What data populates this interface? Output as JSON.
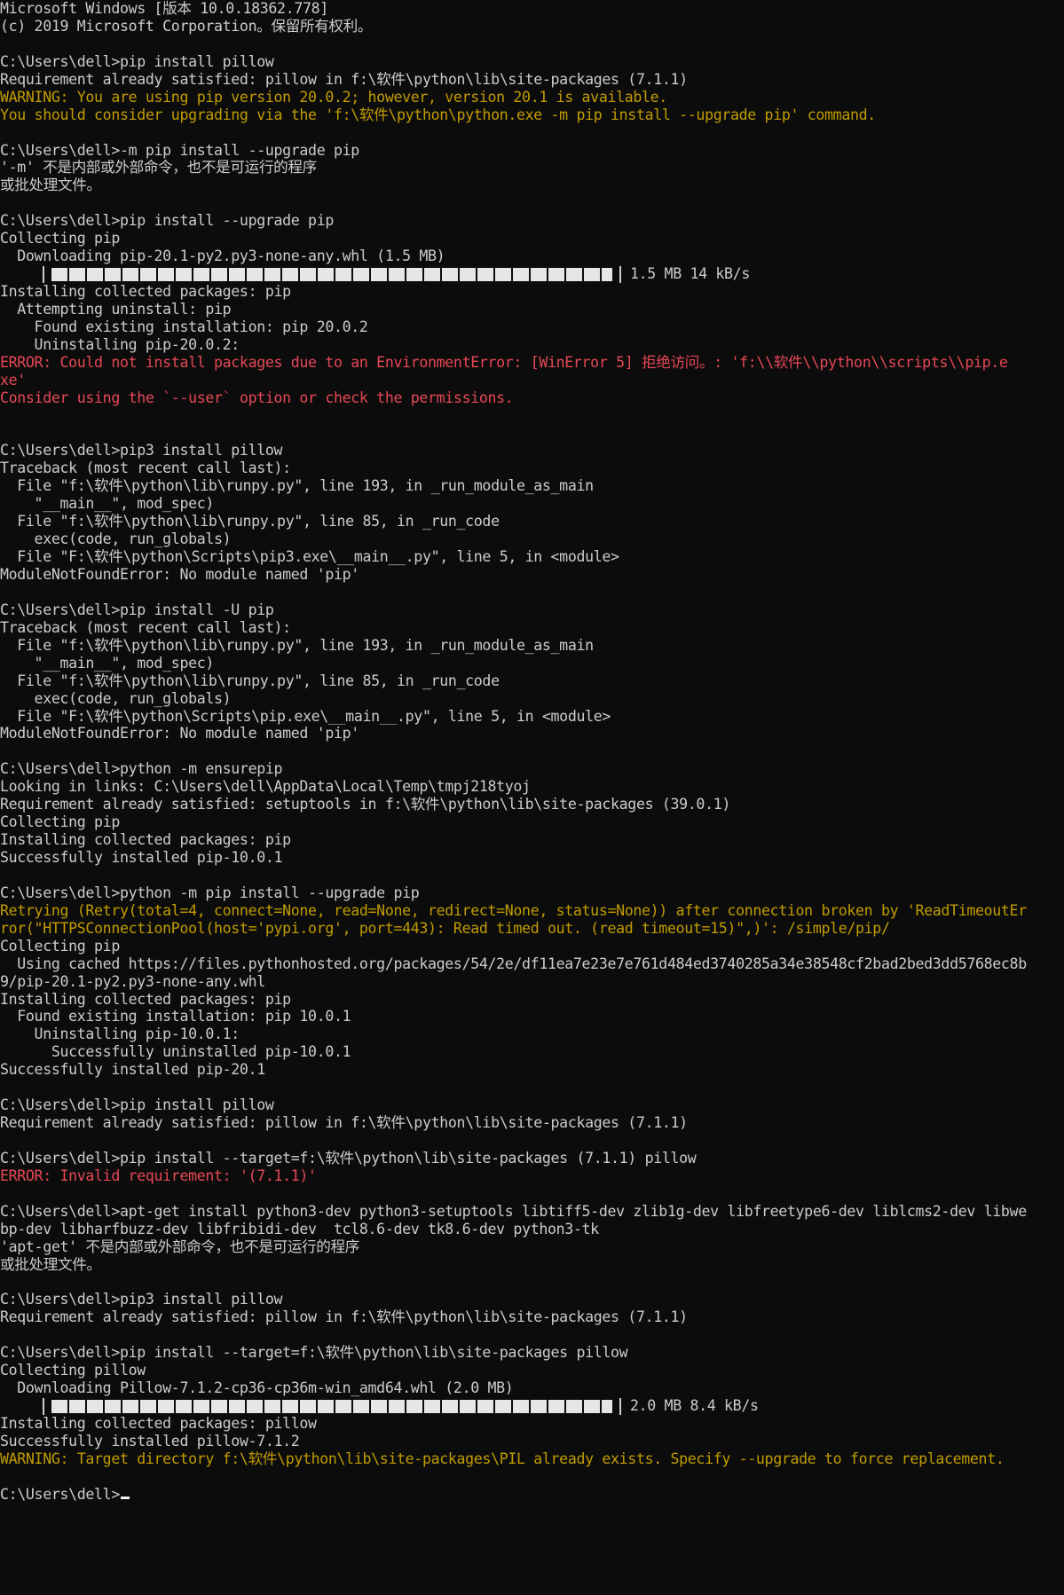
{
  "console": {
    "lines": [
      {
        "t": "Microsoft Windows [版本 10.0.18362.778]",
        "c": "normal"
      },
      {
        "t": "(c) 2019 Microsoft Corporation。保留所有权利。",
        "c": "normal"
      },
      {
        "t": "",
        "c": "normal"
      },
      {
        "t": "C:\\Users\\dell>pip install pillow",
        "c": "normal"
      },
      {
        "t": "Requirement already satisfied: pillow in f:\\软件\\python\\lib\\site-packages (7.1.1)",
        "c": "normal"
      },
      {
        "t": "WARNING: You are using pip version 20.0.2; however, version 20.1 is available.",
        "c": "warn"
      },
      {
        "t": "You should consider upgrading via the 'f:\\软件\\python\\python.exe -m pip install --upgrade pip' command.",
        "c": "warn"
      },
      {
        "t": "",
        "c": "normal"
      },
      {
        "t": "C:\\Users\\dell>-m pip install --upgrade pip",
        "c": "normal"
      },
      {
        "t": "'-m' 不是内部或外部命令，也不是可运行的程序",
        "c": "normal"
      },
      {
        "t": "或批处理文件。",
        "c": "normal"
      },
      {
        "t": "",
        "c": "normal"
      },
      {
        "t": "C:\\Users\\dell>pip install --upgrade pip",
        "c": "normal"
      },
      {
        "t": "Collecting pip",
        "c": "normal"
      },
      {
        "t": "  Downloading pip-20.1-py2.py3-none-any.whl (1.5 MB)",
        "c": "normal"
      },
      {
        "type": "progress",
        "fill": 1.0,
        "text": "1.5 MB 14 kB/s"
      },
      {
        "t": "Installing collected packages: pip",
        "c": "normal"
      },
      {
        "t": "  Attempting uninstall: pip",
        "c": "normal"
      },
      {
        "t": "    Found existing installation: pip 20.0.2",
        "c": "normal"
      },
      {
        "t": "    Uninstalling pip-20.0.2:",
        "c": "normal"
      },
      {
        "t": "ERROR: Could not install packages due to an EnvironmentError: [WinError 5] 拒绝访问。: 'f:\\\\软件\\\\python\\\\scripts\\\\pip.e",
        "c": "err"
      },
      {
        "t": "xe'",
        "c": "err"
      },
      {
        "t": "Consider using the `--user` option or check the permissions.",
        "c": "err"
      },
      {
        "t": "",
        "c": "normal"
      },
      {
        "t": "",
        "c": "normal"
      },
      {
        "t": "C:\\Users\\dell>pip3 install pillow",
        "c": "normal"
      },
      {
        "t": "Traceback (most recent call last):",
        "c": "normal"
      },
      {
        "t": "  File \"f:\\软件\\python\\lib\\runpy.py\", line 193, in _run_module_as_main",
        "c": "normal"
      },
      {
        "t": "    \"__main__\", mod_spec)",
        "c": "normal"
      },
      {
        "t": "  File \"f:\\软件\\python\\lib\\runpy.py\", line 85, in _run_code",
        "c": "normal"
      },
      {
        "t": "    exec(code, run_globals)",
        "c": "normal"
      },
      {
        "t": "  File \"F:\\软件\\python\\Scripts\\pip3.exe\\__main__.py\", line 5, in <module>",
        "c": "normal"
      },
      {
        "t": "ModuleNotFoundError: No module named 'pip'",
        "c": "normal"
      },
      {
        "t": "",
        "c": "normal"
      },
      {
        "t": "C:\\Users\\dell>pip install -U pip",
        "c": "normal"
      },
      {
        "t": "Traceback (most recent call last):",
        "c": "normal"
      },
      {
        "t": "  File \"f:\\软件\\python\\lib\\runpy.py\", line 193, in _run_module_as_main",
        "c": "normal"
      },
      {
        "t": "    \"__main__\", mod_spec)",
        "c": "normal"
      },
      {
        "t": "  File \"f:\\软件\\python\\lib\\runpy.py\", line 85, in _run_code",
        "c": "normal"
      },
      {
        "t": "    exec(code, run_globals)",
        "c": "normal"
      },
      {
        "t": "  File \"F:\\软件\\python\\Scripts\\pip.exe\\__main__.py\", line 5, in <module>",
        "c": "normal"
      },
      {
        "t": "ModuleNotFoundError: No module named 'pip'",
        "c": "normal"
      },
      {
        "t": "",
        "c": "normal"
      },
      {
        "t": "C:\\Users\\dell>python -m ensurepip",
        "c": "normal"
      },
      {
        "t": "Looking in links: C:\\Users\\dell\\AppData\\Local\\Temp\\tmpj218tyoj",
        "c": "normal"
      },
      {
        "t": "Requirement already satisfied: setuptools in f:\\软件\\python\\lib\\site-packages (39.0.1)",
        "c": "normal"
      },
      {
        "t": "Collecting pip",
        "c": "normal"
      },
      {
        "t": "Installing collected packages: pip",
        "c": "normal"
      },
      {
        "t": "Successfully installed pip-10.0.1",
        "c": "normal"
      },
      {
        "t": "",
        "c": "normal"
      },
      {
        "t": "C:\\Users\\dell>python -m pip install --upgrade pip",
        "c": "normal"
      },
      {
        "t": "Retrying (Retry(total=4, connect=None, read=None, redirect=None, status=None)) after connection broken by 'ReadTimeoutEr",
        "c": "warn"
      },
      {
        "t": "ror(\"HTTPSConnectionPool(host='pypi.org', port=443): Read timed out. (read timeout=15)\",)': /simple/pip/",
        "c": "warn"
      },
      {
        "t": "Collecting pip",
        "c": "normal"
      },
      {
        "t": "  Using cached https://files.pythonhosted.org/packages/54/2e/df11ea7e23e7e761d484ed3740285a34e38548cf2bad2bed3dd5768ec8b",
        "c": "normal"
      },
      {
        "t": "9/pip-20.1-py2.py3-none-any.whl",
        "c": "normal"
      },
      {
        "t": "Installing collected packages: pip",
        "c": "normal"
      },
      {
        "t": "  Found existing installation: pip 10.0.1",
        "c": "normal"
      },
      {
        "t": "    Uninstalling pip-10.0.1:",
        "c": "normal"
      },
      {
        "t": "      Successfully uninstalled pip-10.0.1",
        "c": "normal"
      },
      {
        "t": "Successfully installed pip-20.1",
        "c": "normal"
      },
      {
        "t": "",
        "c": "normal"
      },
      {
        "t": "C:\\Users\\dell>pip install pillow",
        "c": "normal"
      },
      {
        "t": "Requirement already satisfied: pillow in f:\\软件\\python\\lib\\site-packages (7.1.1)",
        "c": "normal"
      },
      {
        "t": "",
        "c": "normal"
      },
      {
        "t": "C:\\Users\\dell>pip install --target=f:\\软件\\python\\lib\\site-packages (7.1.1) pillow",
        "c": "normal"
      },
      {
        "t": "ERROR: Invalid requirement: '(7.1.1)'",
        "c": "err"
      },
      {
        "t": "",
        "c": "normal"
      },
      {
        "t": "C:\\Users\\dell>apt-get install python3-dev python3-setuptools libtiff5-dev zlib1g-dev libfreetype6-dev liblcms2-dev libwe",
        "c": "normal"
      },
      {
        "t": "bp-dev libharfbuzz-dev libfribidi-dev  tcl8.6-dev tk8.6-dev python3-tk",
        "c": "normal"
      },
      {
        "t": "'apt-get' 不是内部或外部命令，也不是可运行的程序",
        "c": "normal"
      },
      {
        "t": "或批处理文件。",
        "c": "normal"
      },
      {
        "t": "",
        "c": "normal"
      },
      {
        "t": "C:\\Users\\dell>pip3 install pillow",
        "c": "normal"
      },
      {
        "t": "Requirement already satisfied: pillow in f:\\软件\\python\\lib\\site-packages (7.1.1)",
        "c": "normal"
      },
      {
        "t": "",
        "c": "normal"
      },
      {
        "t": "C:\\Users\\dell>pip install --target=f:\\软件\\python\\lib\\site-packages pillow",
        "c": "normal"
      },
      {
        "t": "Collecting pillow",
        "c": "normal"
      },
      {
        "t": "  Downloading Pillow-7.1.2-cp36-cp36m-win_amd64.whl (2.0 MB)",
        "c": "normal"
      },
      {
        "type": "progress",
        "fill": 1.0,
        "text": "2.0 MB 8.4 kB/s"
      },
      {
        "t": "Installing collected packages: pillow",
        "c": "normal"
      },
      {
        "t": "Successfully installed pillow-7.1.2",
        "c": "normal"
      },
      {
        "t": "WARNING: Target directory f:\\软件\\python\\lib\\site-packages\\PIL already exists. Specify --upgrade to force replacement.",
        "c": "warn"
      },
      {
        "t": "",
        "c": "normal"
      },
      {
        "type": "prompt",
        "t": "C:\\Users\\dell>"
      }
    ]
  },
  "colors": {
    "background": "#0c0c0c",
    "text": "#cccccc",
    "warning": "#c19c00",
    "error": "#e74856"
  }
}
